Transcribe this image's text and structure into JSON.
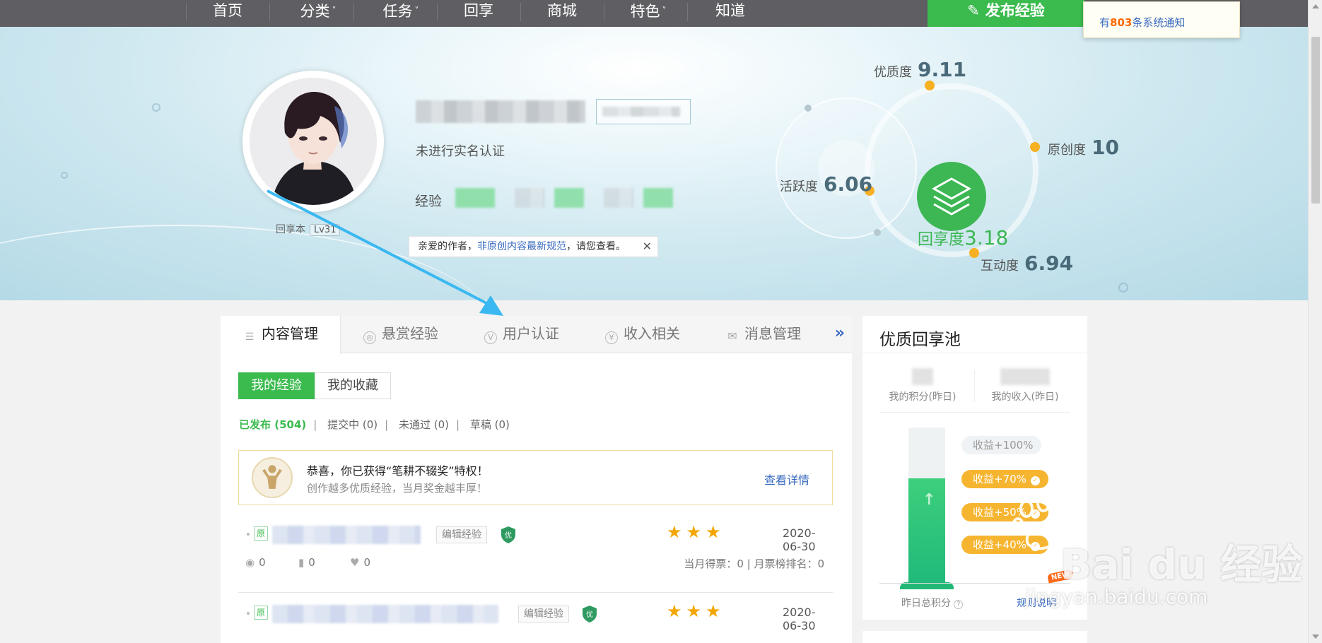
{
  "nav": {
    "items": [
      {
        "label": "首页",
        "caret": false
      },
      {
        "label": "分类",
        "caret": true
      },
      {
        "label": "任务",
        "caret": true
      },
      {
        "label": "回享",
        "caret": false
      },
      {
        "label": "商城",
        "caret": false
      },
      {
        "label": "特色",
        "caret": true
      },
      {
        "label": "知道",
        "caret": false
      }
    ],
    "caret_glyph": "˅",
    "publish_label": "发布经验",
    "publish_icon": "pen-icon"
  },
  "notification": {
    "prefix": "有",
    "count": "803",
    "suffix": "条系统通知"
  },
  "profile": {
    "verify_text": "未进行实名认证",
    "exp_label": "经验",
    "avatar_caption": "回享本",
    "level": "Lv31",
    "tip_prefix": "亲爱的作者，",
    "tip_link": "非原创内容最新规范",
    "tip_suffix": "，请您查看。",
    "tip_close": "✕"
  },
  "scores": {
    "quality": {
      "label": "优质度",
      "value": "9.11"
    },
    "originality": {
      "label": "原创度",
      "value": "10"
    },
    "activity": {
      "label": "活跃度",
      "value": "6.06"
    },
    "interaction": {
      "label": "互动度",
      "value": "6.94"
    },
    "share": {
      "label": "回享度",
      "value": "3.18"
    }
  },
  "tabs": [
    {
      "label": "内容管理",
      "icon": "list-icon",
      "glyph": "☰",
      "active": true
    },
    {
      "label": "悬赏经验",
      "icon": "reward-icon",
      "glyph": "◎",
      "active": false
    },
    {
      "label": "用户认证",
      "icon": "verify-icon",
      "glyph": "V",
      "active": false
    },
    {
      "label": "收入相关",
      "icon": "yen-icon",
      "glyph": "¥",
      "active": false
    },
    {
      "label": "消息管理",
      "icon": "mail-icon",
      "glyph": "✉",
      "active": false
    }
  ],
  "tab_more": "»",
  "subtabs": {
    "mine": "我的经验",
    "favorites": "我的收藏"
  },
  "filters": {
    "published": "已发布 (504)",
    "submitting": "提交中 (0)",
    "rejected": "未通过 (0)",
    "drafts": "草稿 (0)",
    "separator": "|"
  },
  "award": {
    "line1": "恭喜，你已获得“笔耕不辍奖”特权！",
    "line2": "创作越多优质经验，当月奖金越丰厚！",
    "link": "查看详情"
  },
  "experiences": [
    {
      "tag": "原",
      "edit": "编辑经验",
      "badge": "优",
      "stars": "★★★",
      "date": "2020-06-30",
      "views": "0",
      "votes": "0",
      "likes": "0",
      "monthly": "当月得票：0 | 月票榜排名：0"
    },
    {
      "tag": "原",
      "edit": "编辑经验",
      "badge": "优",
      "stars": "★★★",
      "date": "2020-06-30"
    }
  ],
  "stat_icons": {
    "views": "eye-icon",
    "votes": "bar-icon",
    "likes": "heart-icon",
    "views_glyph": "◉",
    "votes_glyph": "▮",
    "likes_glyph": "♥"
  },
  "side": {
    "title": "优质回享池",
    "my_points": "我的积分(昨日)",
    "my_income": "我的收入(昨日)",
    "levels": [
      {
        "label": "收益+100%",
        "active": false
      },
      {
        "label": "收益+70%",
        "active": true
      },
      {
        "label": "收益+50%",
        "active": true
      },
      {
        "label": "收益+40%",
        "active": true
      }
    ],
    "check_glyph": "✓",
    "tube_arrow": "↑",
    "total_label": "昨日总积分",
    "help_glyph": "?",
    "rules_link": "规则说明",
    "new_badge": "NEW"
  },
  "watermark": {
    "brand": "Bai du 经验",
    "url": "jingyan.baidu.com"
  },
  "colors": {
    "green": "#3bbb4e",
    "orange": "#f6b022",
    "link": "#3a6bc0",
    "nav": "#5f5f63"
  }
}
